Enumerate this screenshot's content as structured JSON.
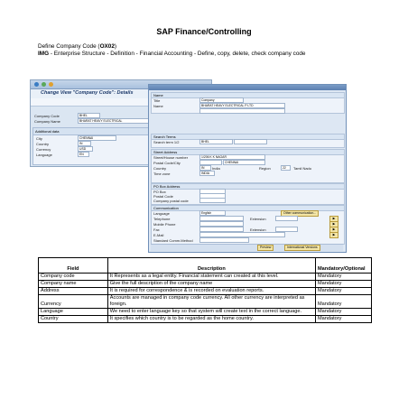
{
  "page_title": "SAP Finance/Controlling",
  "intro": {
    "line1_prefix": "Define Company Code (",
    "line1_code": "OX02",
    "line1_suffix": ")",
    "img_label": "IMG",
    "img_text": " - Enterprise Structure - Definition - Financial Accounting - Define, copy, delete, check company code"
  },
  "background_window": {
    "header_title": "Change View \"Company Code\": Details",
    "company_code_label": "Company Code",
    "company_code_value": "BHEL",
    "company_name_label": "Company Name",
    "company_name_value": "BHARAT HEAVY ELECTRICAL",
    "additional_data_title": "Additional data",
    "city_label": "City",
    "city_value": "CHENNAI",
    "country_label": "Country",
    "country_value": "IN",
    "currency_label": "Currency",
    "currency_value": "USD",
    "language_label": "Language",
    "language_value": "EN"
  },
  "dialog": {
    "name_section": "Name",
    "title_label": "Title",
    "title_value": "Company",
    "name_label": "Name",
    "name_value": "BHARAT HEAVY ELECTRICAL P LTD",
    "search_section": "Search Terms",
    "search_label": "Search term 1/2",
    "search_value": "BHEL",
    "street_section": "Street Address",
    "street_label": "Street/House number",
    "street_value": "1/206 K K NAGAR",
    "postal_label": "Postal Code/City",
    "city_value": "CHENNAI",
    "country_label": "Country",
    "country_value": "IN",
    "country_name": "India",
    "region_label": "Region",
    "region_value": "22",
    "region_name": "Tamil Nadu",
    "timezone_label": "Time zone",
    "timezone_value": "INDIA",
    "pobox_section": "PO Box Address",
    "pobox_label": "PO Box",
    "pobox_postal_label": "Postal Code",
    "company_postal_label": "Company postal code",
    "comm_section": "Communication",
    "language_label": "Language",
    "language_value": "English",
    "other_comm_button": "Other communication...",
    "telephone_label": "Telephone",
    "extension_label": "Extension",
    "mobile_label": "Mobile Phone",
    "fax_label": "Fax",
    "fax_extension_label": "Extension",
    "email_label": "E-Mail",
    "std_comm_label": "Standard Comm.Method",
    "data_line_label": "Data line",
    "telebox_label": "Telebox",
    "comments_label": "Comments",
    "preview_button": "Preview",
    "intl_versions_button": "International Versions"
  },
  "table": {
    "headers": [
      "Field",
      "Description",
      "Mandatory/Optional"
    ],
    "rows": [
      [
        "Company code",
        "It Represents as a legal entity. Financial statement can created at this level.",
        "Mandatory"
      ],
      [
        "Company name",
        "Give the full description of the company name",
        "Mandatory"
      ],
      [
        "Address",
        "It is required for correspondence & is recorded on evaluation reports.",
        "Mandatory"
      ],
      [
        "Currency",
        "Accounts are managed in company code currency. All other currency are  interpreted as foreign.",
        "Mandatory"
      ],
      [
        "Language",
        "We need to enter language key so that system will create text in the correct language.",
        "Mandatory"
      ],
      [
        "Country",
        "It specifies which country is to be regarded as the home country.",
        "Mandatory"
      ]
    ]
  }
}
